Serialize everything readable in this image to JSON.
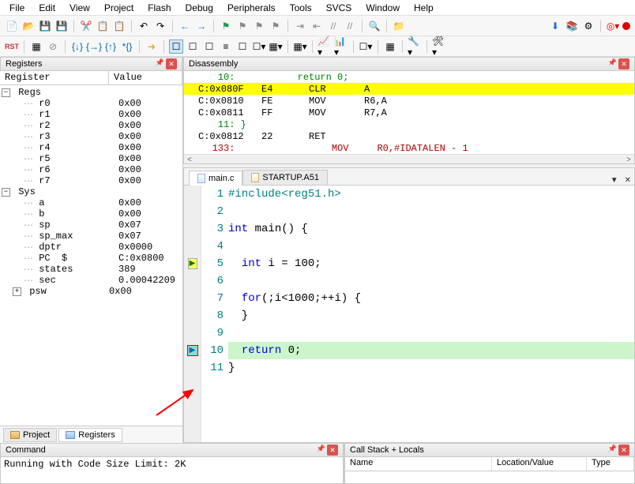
{
  "menu": [
    "File",
    "Edit",
    "View",
    "Project",
    "Flash",
    "Debug",
    "Peripherals",
    "Tools",
    "SVCS",
    "Window",
    "Help"
  ],
  "panels": {
    "registers_title": "Registers",
    "register_col": "Register",
    "value_col": "Value",
    "disassembly_title": "Disassembly",
    "command_title": "Command",
    "callstack_title": "Call Stack + Locals",
    "call_cols": {
      "name": "Name",
      "locval": "Location/Value",
      "type": "Type"
    }
  },
  "registers": {
    "group1": "Regs",
    "regs": [
      {
        "n": "r0",
        "v": "0x00"
      },
      {
        "n": "r1",
        "v": "0x00"
      },
      {
        "n": "r2",
        "v": "0x00"
      },
      {
        "n": "r3",
        "v": "0x00"
      },
      {
        "n": "r4",
        "v": "0x00"
      },
      {
        "n": "r5",
        "v": "0x00"
      },
      {
        "n": "r6",
        "v": "0x00"
      },
      {
        "n": "r7",
        "v": "0x00"
      }
    ],
    "group2": "Sys",
    "sys": [
      {
        "n": "a",
        "v": "0x00"
      },
      {
        "n": "b",
        "v": "0x00"
      },
      {
        "n": "sp",
        "v": "0x07"
      },
      {
        "n": "sp_max",
        "v": "0x07"
      },
      {
        "n": "dptr",
        "v": "0x0000"
      },
      {
        "n": "PC  $",
        "v": "C:0x0800"
      },
      {
        "n": "states",
        "v": "389"
      },
      {
        "n": "sec",
        "v": "0.00042209"
      },
      {
        "n": "psw",
        "v": "0x00",
        "exp": true
      }
    ]
  },
  "disasm": [
    {
      "src": true,
      "text": "    10:           return 0;"
    },
    {
      "addr": "C:0x080F",
      "hex": "E4",
      "mn": "CLR",
      "op": "A",
      "hl": true
    },
    {
      "addr": "C:0x0810",
      "hex": "FE",
      "mn": "MOV",
      "op": "R6,A"
    },
    {
      "addr": "C:0x0811",
      "hex": "FF",
      "mn": "MOV",
      "op": "R7,A"
    },
    {
      "src": true,
      "text": "    11: }"
    },
    {
      "addr": "C:0x0812",
      "hex": "22",
      "mn": "RET",
      "op": ""
    },
    {
      "src": true,
      "red": true,
      "text": "   133:                 MOV     R0,#IDATALEN - 1"
    }
  ],
  "editor": {
    "tabs": [
      {
        "label": "main.c",
        "active": true
      },
      {
        "label": "STARTUP.A51",
        "active": false
      }
    ],
    "lines": [
      {
        "n": 1,
        "html": "<span class='pp'>#include&lt;reg51.h&gt;</span>"
      },
      {
        "n": 2,
        "html": ""
      },
      {
        "n": 3,
        "html": "<span class='kw'>int</span> main() {"
      },
      {
        "n": 4,
        "html": ""
      },
      {
        "n": 5,
        "html": "  <span class='kw'>int</span> i = 100;",
        "mark": "cur"
      },
      {
        "n": 6,
        "html": ""
      },
      {
        "n": 7,
        "html": "  <span class='kw'>for</span>(;i&lt;1000;++i) {"
      },
      {
        "n": 8,
        "html": "  }"
      },
      {
        "n": 9,
        "html": ""
      },
      {
        "n": 10,
        "html": "  <span class='kw'>return</span> 0;",
        "mark": "bp",
        "hl": true
      },
      {
        "n": 11,
        "html": "}"
      }
    ]
  },
  "bottom_tabs": [
    {
      "label": "Project"
    },
    {
      "label": "Registers",
      "active": true
    }
  ],
  "command_text": "Running with Code Size Limit: 2K"
}
